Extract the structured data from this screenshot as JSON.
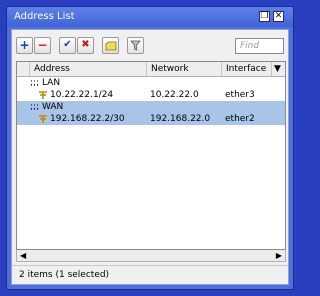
{
  "window": {
    "title": "Address List",
    "restore_icon": "restore-icon",
    "close_icon": "close-icon"
  },
  "toolbar": {
    "buttons": [
      {
        "name": "add-icon",
        "glyph": "+",
        "color": "#1a3fb8"
      },
      {
        "name": "remove-icon",
        "glyph": "−",
        "color": "#c71a1a"
      },
      {
        "name": "enable-icon",
        "glyph": "✔",
        "color": "#1a3fb8"
      },
      {
        "name": "disable-icon",
        "glyph": "✖",
        "color": "#c71a1a"
      },
      {
        "name": "comment-icon",
        "glyph": "",
        "color": "#f0d860"
      },
      {
        "name": "filter-icon",
        "glyph": "",
        "color": "#888888"
      }
    ],
    "find_placeholder": "Find"
  },
  "table": {
    "columns": [
      "Address",
      "Network",
      "Interface"
    ],
    "groups": [
      {
        "label": ";;; LAN",
        "address": "10.22.22.1/24",
        "network": "10.22.22.0",
        "interface": "ether3",
        "selected": false
      },
      {
        "label": ";;; WAN",
        "address": "192.168.22.2/30",
        "network": "192.168.22.0",
        "interface": "ether2",
        "selected": true
      }
    ],
    "row_icon": "address-plug-icon"
  },
  "status": {
    "text": "2 items (1 selected)"
  },
  "colors": {
    "selection": "#a8c4e8",
    "window_bg": "#4f6fdc",
    "desktop": "#2a3fbf"
  }
}
